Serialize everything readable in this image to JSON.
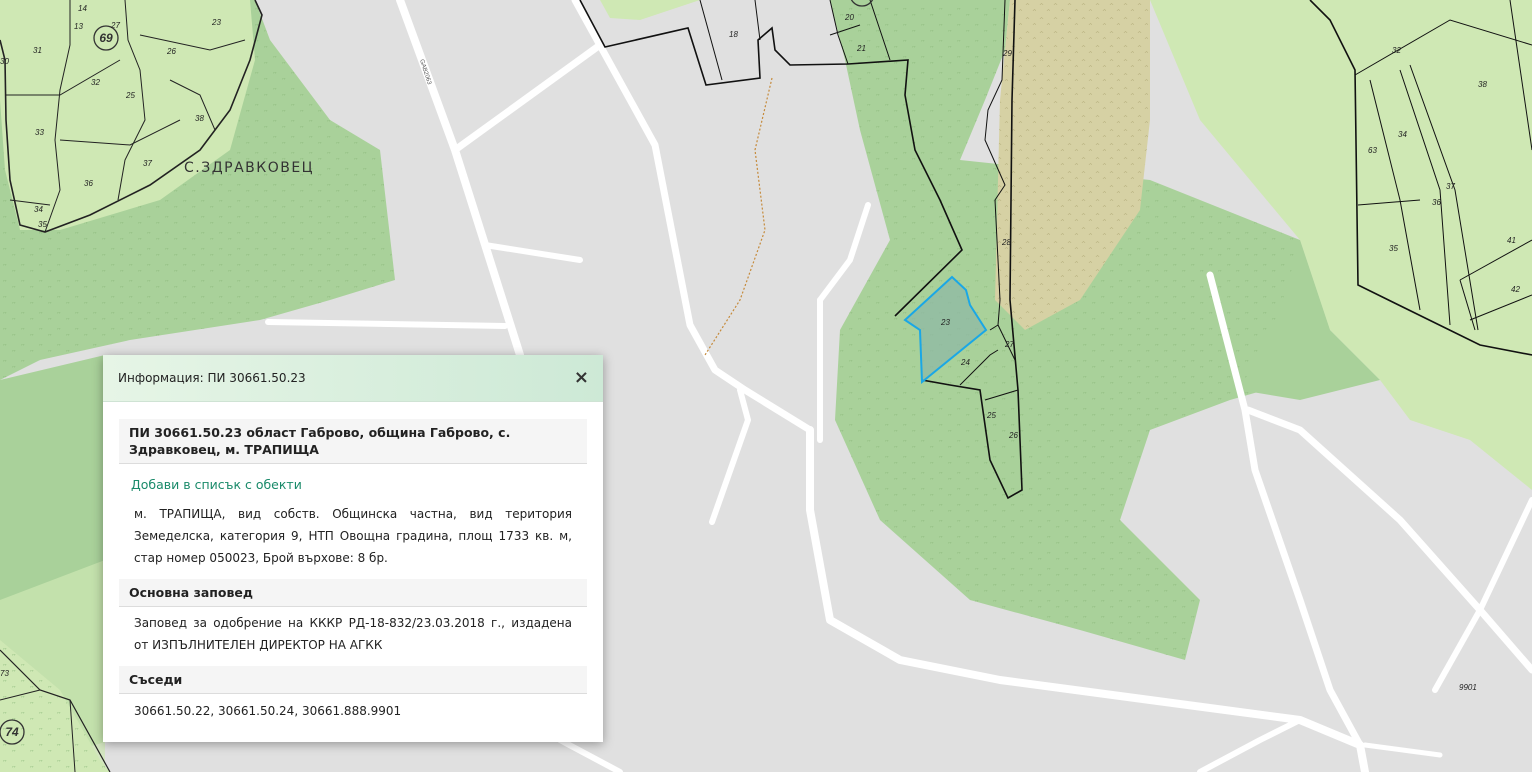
{
  "map": {
    "village_label": "С.ЗДРАВКОВЕЦ",
    "road_label": "GAB2063",
    "circle_labels": [
      "69",
      "74"
    ],
    "parcel_labels": [
      "14",
      "27",
      "23",
      "13",
      "31",
      "26",
      "32",
      "25",
      "33",
      "38",
      "37",
      "36",
      "34",
      "35",
      "30",
      "18",
      "20",
      "21",
      "29",
      "28",
      "23",
      "27",
      "24",
      "25",
      "26",
      "32",
      "38",
      "34",
      "63",
      "36",
      "37",
      "35",
      "41",
      "42",
      "9901",
      "73"
    ],
    "colors": {
      "background": "#e0e0e0",
      "forest": "#a9d19a",
      "forest_dark": "#9cc88c",
      "meadow": "#cfe8b4",
      "orchard_hatch": "#d6d1a4",
      "road": "#ffffff",
      "boundary": "#111111",
      "selection": "#1aa7e6",
      "selection_fill": "#8fb8a4"
    }
  },
  "popup": {
    "title": "Информация: ПИ 30661.50.23",
    "close_label": "×",
    "heading": "ПИ 30661.50.23 област Габрово, община Габрово, с. Здравковец, м. ТРАПИЩА",
    "add_link": "Добави в списък с обекти",
    "details": "м. ТРАПИЩА, вид собств. Общинска частна, вид територия Земеделска, категория 9, НТП Овощна градина, площ 1733 кв. м, стар номер 050023, Брой върхове: 8 бр.",
    "order_heading": "Основна заповед",
    "order_text": "Заповед за одобрение на КККР РД-18-832/23.03.2018 г., издадена от ИЗПЪЛНИТЕЛЕН ДИРЕКТОР НА АГКК",
    "neighbors_heading": "Съседи",
    "neighbors_text": "30661.50.22, 30661.50.24, 30661.888.9901"
  }
}
